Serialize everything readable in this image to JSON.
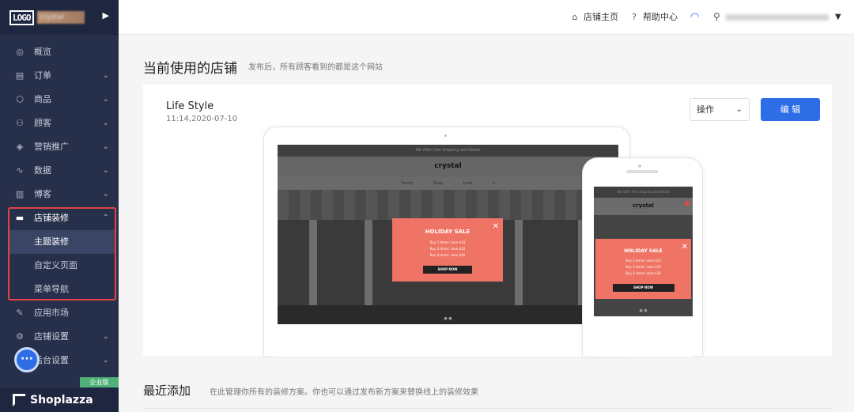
{
  "sidebar": {
    "logo_text": "LOGO",
    "store_name": "crystal",
    "toggle_icon": "caret-right-icon",
    "items": [
      {
        "label": "概览",
        "icon": "dashboard-icon",
        "chevron": false
      },
      {
        "label": "订单",
        "icon": "order-icon",
        "chevron": true
      },
      {
        "label": "商品",
        "icon": "product-icon",
        "chevron": true
      },
      {
        "label": "顾客",
        "icon": "customer-icon",
        "chevron": true
      },
      {
        "label": "营销推广",
        "icon": "marketing-icon",
        "chevron": true
      },
      {
        "label": "数据",
        "icon": "analytics-icon",
        "chevron": true
      },
      {
        "label": "博客",
        "icon": "blog-icon",
        "chevron": true
      },
      {
        "label": "店铺装修",
        "icon": "store-design-icon",
        "chevron": true,
        "open": true
      },
      {
        "label": "应用市场",
        "icon": "apps-icon",
        "chevron": false
      },
      {
        "label": "店铺设置",
        "icon": "store-settings-icon",
        "chevron": true
      },
      {
        "label": "后台设置",
        "icon": "admin-settings-icon",
        "chevron": true
      }
    ],
    "sub_items": [
      {
        "label": "主题装修",
        "active": true
      },
      {
        "label": "自定义页面",
        "active": false
      },
      {
        "label": "菜单导航",
        "active": false
      }
    ],
    "edition_badge": "企业版",
    "brand": "Shoplazza",
    "highlight_color": "#e34242"
  },
  "topbar": {
    "store_home": "店铺主页",
    "help_center": "帮助中心",
    "user_email": "••••••••••••••••••••"
  },
  "main": {
    "title": "当前使用的店铺",
    "subtitle": "发布后，所有顾客看到的都是这个网站",
    "theme": {
      "name": "Life Style",
      "date": "11:14,2020-07-10"
    },
    "operation_select": "操作",
    "edit_button": "编 辑",
    "accent_color": "#2d6ee6",
    "preview": {
      "announcement": "We offer free shipping worldwide",
      "brand": "crystal",
      "nav": "Home Shop Look ▾",
      "popup_title": "HOLIDAY SALE",
      "popup_lines": [
        "Buy 2 items' save $10",
        "Buy 3 items' save $20",
        "Buy 4 items' save $30"
      ],
      "popup_button": "SHOP NOW",
      "popup_color": "#f07465"
    },
    "section2_title": "最近添加",
    "section2_subtitle": "在此管理你所有的装修方案。你也可以通过发布新方案来替换线上的装修效果"
  }
}
